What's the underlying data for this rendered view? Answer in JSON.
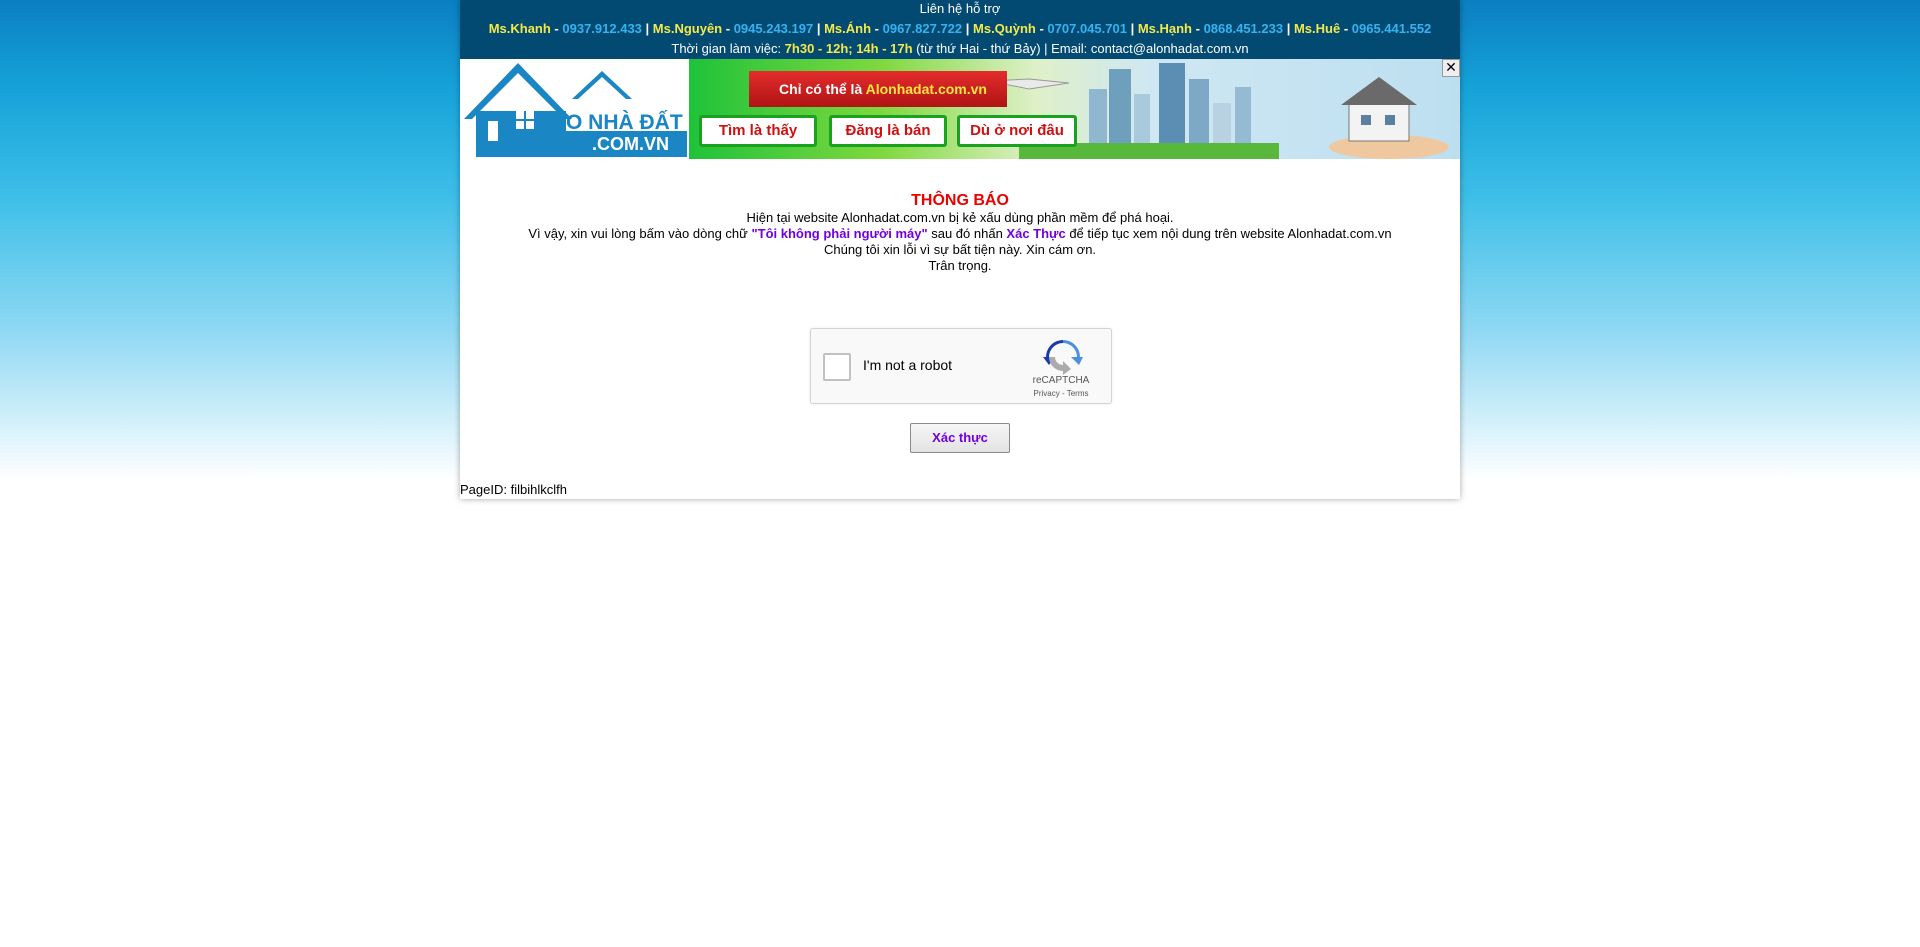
{
  "support": {
    "title": "Liên hệ hỗ trợ",
    "contacts": [
      {
        "name": "Ms.Khanh",
        "phone": "0937.912.433"
      },
      {
        "name": "Ms.Nguyên",
        "phone": "0945.243.197"
      },
      {
        "name": "Ms.Ánh",
        "phone": "0967.827.722"
      },
      {
        "name": "Ms.Quỳnh",
        "phone": "0707.045.701"
      },
      {
        "name": "Ms.Hạnh",
        "phone": "0868.451.233"
      },
      {
        "name": "Ms.Huê",
        "phone": "0965.441.552"
      }
    ],
    "hours_prefix": "Thời gian làm việc: ",
    "hours_value": "7h30 - 12h; 14h - 17h",
    "hours_suffix": " (từ thứ Hai - thứ Bảy) | Email: contact@alonhadat.com.vn"
  },
  "banner": {
    "logo_main": "ALO NHÀ ĐẤT",
    "logo_sub": ".COM.VN",
    "ribbon_prefix": "Chỉ có thể là ",
    "ribbon_brand": "Alonhadat.com.vn",
    "pills": [
      "Tìm là thấy",
      "Đăng là bán",
      "Dù ở nơi đâu"
    ],
    "close_label": "✕"
  },
  "notice": {
    "title": "THÔNG BÁO",
    "line1": "Hiện tại website Alonhadat.com.vn bị kẻ xấu dùng phần mềm để phá hoại.",
    "line2_a": "Vì vậy, xin vui lòng bấm vào dòng chữ ",
    "line2_b": "\"Tôi không phải người máy\"",
    "line2_c": " sau đó nhấn ",
    "line2_d": "Xác Thực",
    "line2_e": " để tiếp tục xem nội dung trên website Alonhadat.com.vn",
    "line3": "Chúng tôi xin lỗi vì sự bất tiện này. Xin cám ơn.",
    "line4": "Trân trọng."
  },
  "captcha": {
    "label": "I'm not a robot",
    "brand": "reCAPTCHA",
    "links": "Privacy - Terms"
  },
  "verify_button": "Xác thực",
  "page_id": "PageID: filbihlkclfh",
  "colors": {
    "topbar": "#034a72",
    "name_yellow": "#f5e94a",
    "phone_blue": "#35b3f0",
    "title_red": "#e00000",
    "accent_purple": "#7000e0"
  }
}
